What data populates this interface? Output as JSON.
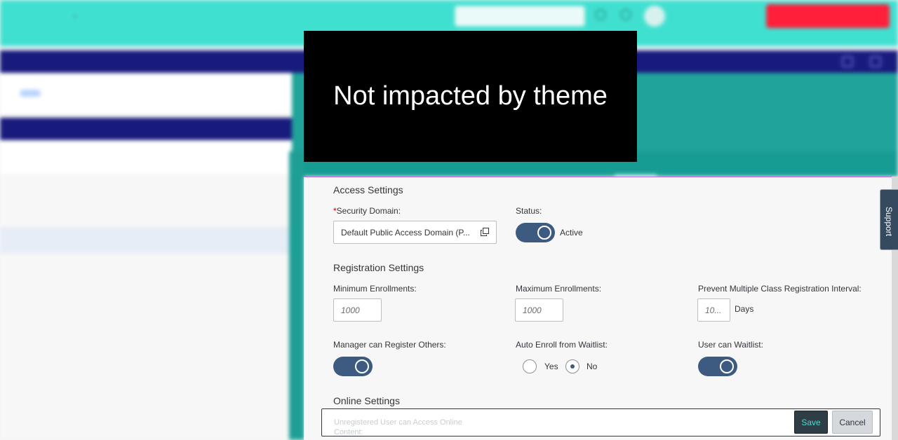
{
  "overlay": {
    "message": "Not impacted by theme"
  },
  "access_settings": {
    "title": "Access Settings",
    "security_domain": {
      "required_mark": "*",
      "label": "Security Domain:",
      "value": "Default Public Access Domain (P...",
      "icon": "copy-icon"
    },
    "status": {
      "label": "Status:",
      "state": "on",
      "state_text": "Active"
    }
  },
  "registration_settings": {
    "title": "Registration Settings",
    "min_enrollments": {
      "label": "Minimum Enrollments:",
      "placeholder": "1000"
    },
    "max_enrollments": {
      "label": "Maximum Enrollments:",
      "placeholder": "1000"
    },
    "prevent_interval": {
      "label": "Prevent Multiple Class Registration Interval:",
      "placeholder": "10...",
      "unit": "Days"
    },
    "manager_register": {
      "label": "Manager can Register Others:",
      "state": "on"
    },
    "auto_enroll": {
      "label": "Auto Enroll from Waitlist:",
      "options": [
        "Yes",
        "No"
      ],
      "selected": "No"
    },
    "user_waitlist": {
      "label": "User can Waitlist:",
      "state": "on"
    }
  },
  "online_settings": {
    "title": "Online Settings",
    "partial_label": "Unregistered User can Access Online Content:"
  },
  "footer": {
    "save_label": "Save",
    "cancel_label": "Cancel"
  },
  "support_tab": {
    "label": "Support"
  },
  "colors": {
    "accent_teal": "#40e0d0",
    "toggle_on": "#3d5a80",
    "nav_dark": "#181a7c",
    "cta_red": "#ff1f3a"
  }
}
